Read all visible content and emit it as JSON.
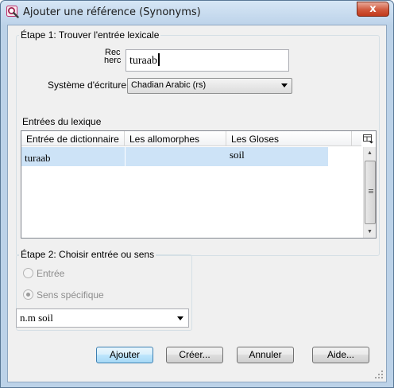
{
  "window": {
    "title": "Ajouter une référence (Synonyms)",
    "close_glyph": "x",
    "app_icon": "magnifier-app-icon"
  },
  "step1": {
    "legend": "Étape 1: Trouver l'entrée lexicale",
    "search_label_line1": "Rec",
    "search_label_line2": "herc",
    "search_value": "turaab",
    "writing_system_label": "Système d'écriture:",
    "writing_system_value": "Chadian Arabic (rs)"
  },
  "lexicon": {
    "label": "Entrées du lexique",
    "columns": [
      "Entrée de dictionnaire",
      "Les allomorphes",
      "Les Gloses"
    ],
    "rows": [
      {
        "entry": "turaab",
        "allomorphs": "",
        "gloss": "soil"
      }
    ],
    "column_chooser_icon": "column-chooser-icon"
  },
  "step2": {
    "legend": "Étape 2: Choisir entrée ou sens",
    "radio_entry": "Entrée",
    "radio_sense": "Sens spécifique",
    "selected": "sense",
    "sense_value": "n.m soil"
  },
  "buttons": {
    "add": "Ajouter",
    "create": "Créer...",
    "cancel": "Annuler",
    "help": "Aide..."
  },
  "colors": {
    "selection": "#cde3f7",
    "default_button_border": "#3c7fb1",
    "close_button": "#c2391b"
  }
}
